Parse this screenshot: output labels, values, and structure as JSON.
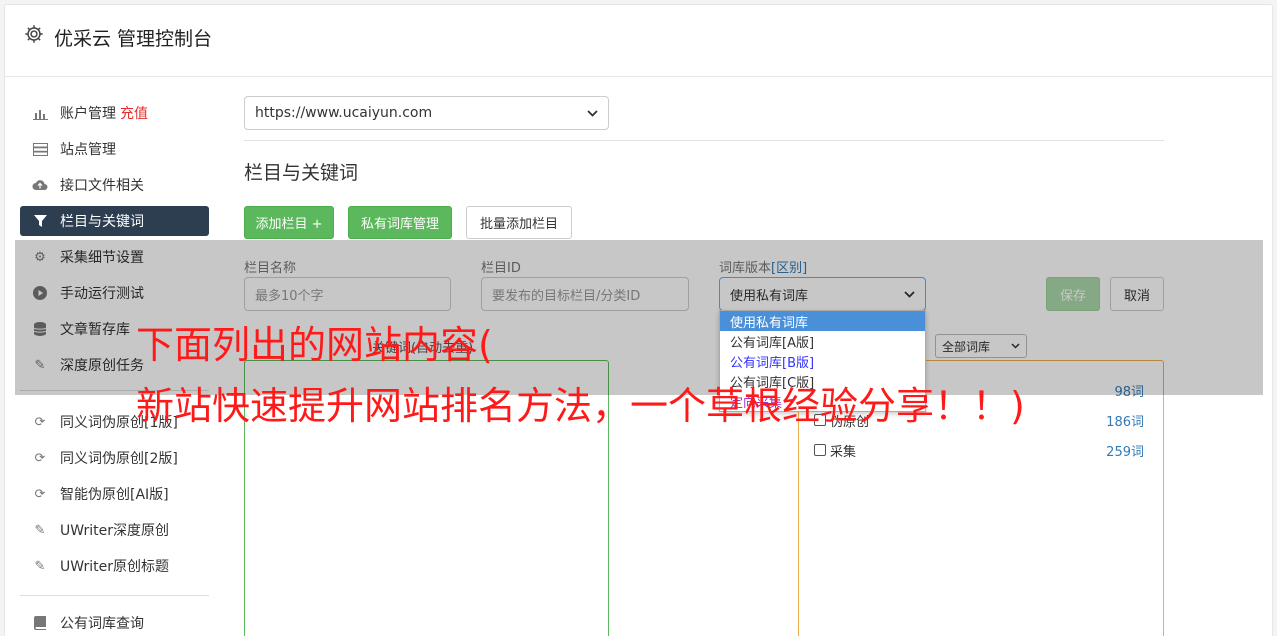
{
  "header": {
    "title": "优采云 管理控制台"
  },
  "sidebar": {
    "items": [
      {
        "label": "账户管理",
        "badge": "充值",
        "icon": "bar-chart-icon"
      },
      {
        "label": "站点管理",
        "icon": "server-icon"
      },
      {
        "label": "接口文件相关",
        "icon": "cloud-upload-icon"
      },
      {
        "label": "栏目与关键词",
        "icon": "filter-icon",
        "active": true
      },
      {
        "label": "采集细节设置",
        "icon": "cogs-icon"
      },
      {
        "label": "手动运行测试",
        "icon": "play-icon"
      },
      {
        "label": "文章暂存库",
        "icon": "database-icon"
      },
      {
        "label": "深度原创任务",
        "icon": "edit-icon"
      },
      {
        "label": "同义词伪原创[1版]",
        "icon": "refresh-icon"
      },
      {
        "label": "同义词伪原创[2版]",
        "icon": "refresh-icon"
      },
      {
        "label": "智能伪原创[AI版]",
        "icon": "refresh-icon"
      },
      {
        "label": "UWriter深度原创",
        "icon": "edit-icon"
      },
      {
        "label": "UWriter原创标题",
        "icon": "edit-icon"
      },
      {
        "label": "公有词库查询",
        "icon": "book-icon"
      }
    ]
  },
  "main": {
    "site_select": "https://www.ucaiyun.com",
    "section_title": "栏目与关键词",
    "buttons": {
      "add_column": "添加栏目 +",
      "private_lib": "私有词库管理",
      "batch_add": "批量添加栏目"
    },
    "form": {
      "name_label": "栏目名称",
      "name_placeholder": "最多10个字",
      "id_label": "栏目ID",
      "id_placeholder": "要发布的目标栏目/分类ID",
      "version_label": "词库版本",
      "version_label_link": "[区别]",
      "version_value": "使用私有词库",
      "save": "保存",
      "cancel": "取消"
    },
    "dropdown_options": [
      "使用私有词库",
      "公有词库[A版]",
      "公有词库[B版]",
      "公有词库[C版]",
      "定向采集"
    ],
    "left_panel_title": "关键词(自动去重)",
    "right_filter": "全部词库",
    "wordlib": [
      {
        "name": "",
        "count": "98词"
      },
      {
        "name": "伪原创",
        "count": "186词"
      },
      {
        "name": "采集",
        "count": "259词"
      }
    ]
  },
  "overlay": {
    "caption_line1": "下面列出的网站内容(",
    "caption_line2": "新站快速提升网站排名方法，一个草根经验分享！！)"
  }
}
